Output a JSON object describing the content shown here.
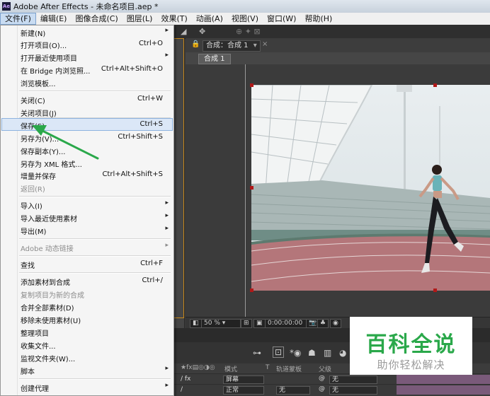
{
  "window": {
    "title": "Adobe After Effects - 未命名项目.aep *",
    "app_icon": "Ae"
  },
  "menubar": [
    {
      "label": "文件(F)"
    },
    {
      "label": "编辑(E)"
    },
    {
      "label": "图像合成(C)"
    },
    {
      "label": "图层(L)"
    },
    {
      "label": "效果(T)"
    },
    {
      "label": "动画(A)"
    },
    {
      "label": "视图(V)"
    },
    {
      "label": "窗口(W)"
    },
    {
      "label": "帮助(H)"
    }
  ],
  "file_menu": {
    "items": [
      {
        "label": "新建(N)",
        "shortcut": "",
        "arrow": "▸"
      },
      {
        "label": "打开项目(O)...",
        "shortcut": "Ctrl+O",
        "arrow": ""
      },
      {
        "label": "打开最近使用项目",
        "shortcut": "",
        "arrow": "▸"
      },
      {
        "label": "在 Bridge 内浏览照...",
        "shortcut": "Ctrl+Alt+Shift+O",
        "arrow": ""
      },
      {
        "label": "浏览模板...",
        "shortcut": "",
        "arrow": ""
      },
      {
        "label": "关闭(C)",
        "shortcut": "Ctrl+W",
        "arrow": ""
      },
      {
        "label": "关闭项目(J)",
        "shortcut": "",
        "arrow": ""
      },
      {
        "label": "保存(S)",
        "shortcut": "Ctrl+S",
        "arrow": ""
      },
      {
        "label": "另存为(V)...",
        "shortcut": "Ctrl+Shift+S",
        "arrow": ""
      },
      {
        "label": "保存副本(Y)...",
        "shortcut": "",
        "arrow": ""
      },
      {
        "label": "另存为 XML 格式...",
        "shortcut": "",
        "arrow": ""
      },
      {
        "label": "增量并保存",
        "shortcut": "Ctrl+Alt+Shift+S",
        "arrow": ""
      },
      {
        "label": "返回(R)",
        "shortcut": "",
        "arrow": ""
      },
      {
        "label": "导入(I)",
        "shortcut": "",
        "arrow": "▸"
      },
      {
        "label": "导入最近使用素材",
        "shortcut": "",
        "arrow": "▸"
      },
      {
        "label": "导出(M)",
        "shortcut": "",
        "arrow": "▸"
      },
      {
        "label": "Adobe 动态链接",
        "shortcut": "",
        "arrow": "▸"
      },
      {
        "label": "查找",
        "shortcut": "Ctrl+F",
        "arrow": ""
      },
      {
        "label": "添加素材到合成",
        "shortcut": "Ctrl+/",
        "arrow": ""
      },
      {
        "label": "复制项目为新的合成",
        "shortcut": "",
        "arrow": ""
      },
      {
        "label": "合并全部素材(D)",
        "shortcut": "",
        "arrow": ""
      },
      {
        "label": "移除未使用素材(U)",
        "shortcut": "",
        "arrow": ""
      },
      {
        "label": "整理项目",
        "shortcut": "",
        "arrow": ""
      },
      {
        "label": "收集文件...",
        "shortcut": "",
        "arrow": ""
      },
      {
        "label": "监视文件夹(W)...",
        "shortcut": "",
        "arrow": ""
      },
      {
        "label": "脚本",
        "shortcut": "",
        "arrow": "▸"
      },
      {
        "label": "创建代理",
        "shortcut": "",
        "arrow": "▸"
      }
    ]
  },
  "composition": {
    "tab_label": "合成：合成 1",
    "tab_close": "×",
    "subtab": "合成 1",
    "zoom": "50 %",
    "timecode": "0:00:00:00"
  },
  "timeline": {
    "header": {
      "col_mode": "模式",
      "col_t": "T",
      "col_trkmat": "轨道蒙板",
      "col_parent": "父级"
    },
    "rows": [
      {
        "mode": "屏幕",
        "parent": "无"
      },
      {
        "mode": "正常",
        "trkmat": "无",
        "parent": "无"
      }
    ]
  },
  "watermark": {
    "title": "百科全说",
    "subtitle": "助你轻松解决"
  },
  "colors": {
    "menu_highlight": "#dbe7f7",
    "arrow": "#2aa84a",
    "handle": "#b01818",
    "panel_border": "#c98a1c"
  }
}
